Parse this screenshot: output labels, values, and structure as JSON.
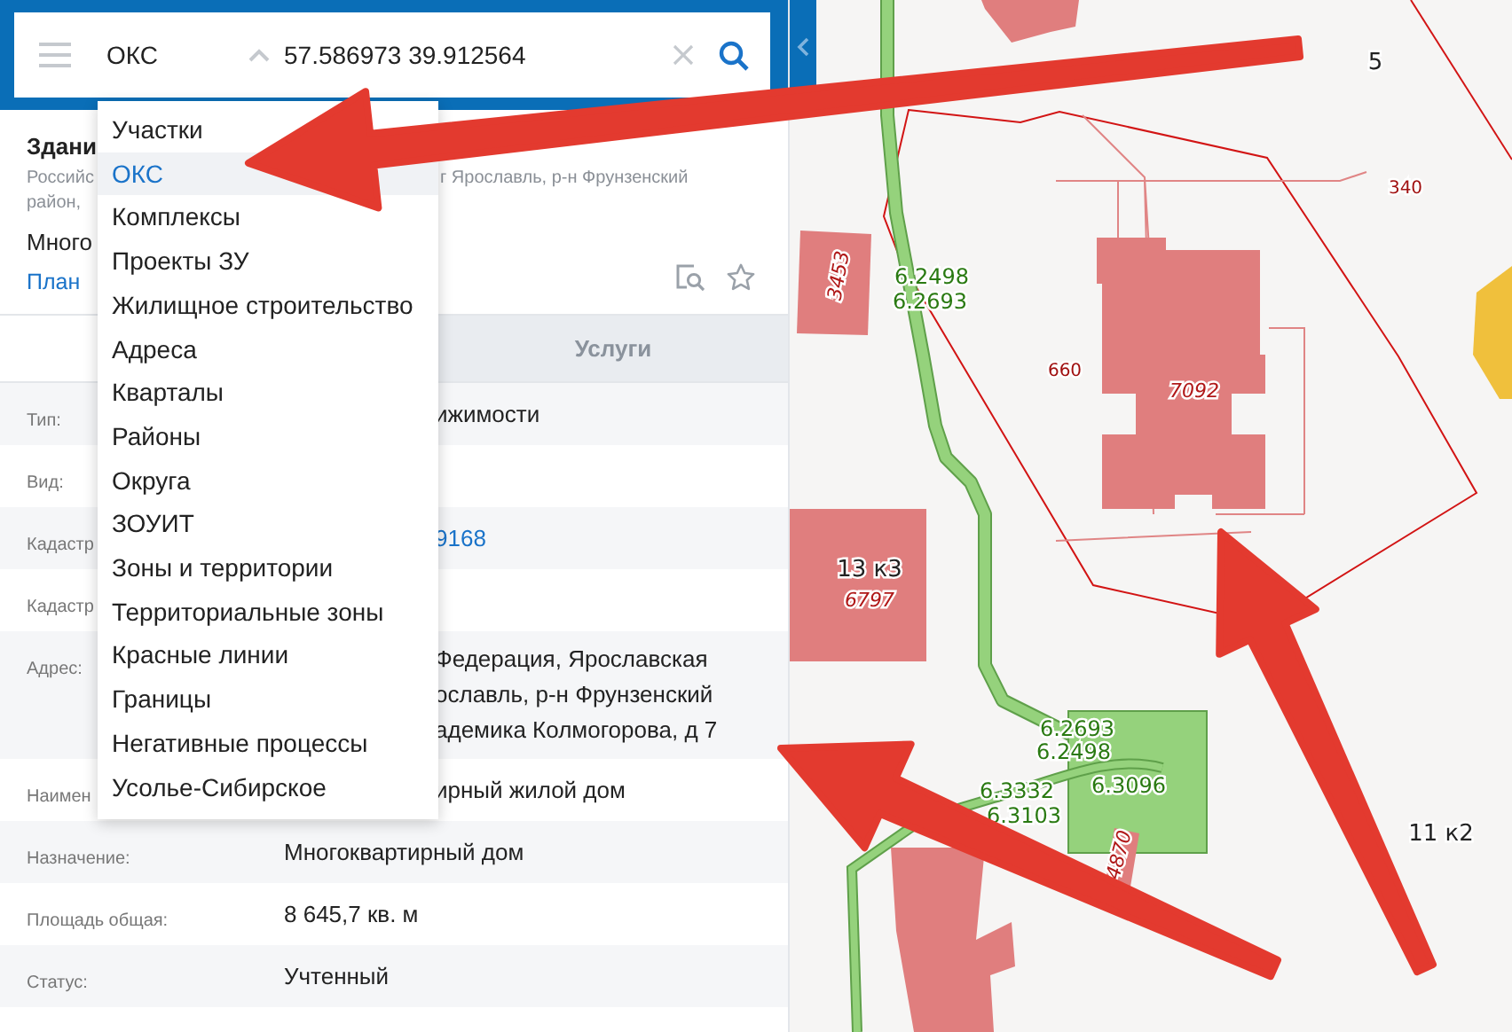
{
  "search": {
    "category": "ОКС",
    "query": "57.586973 39.912564"
  },
  "category_menu": {
    "items": [
      {
        "label": "Участки",
        "selected": false
      },
      {
        "label": "ОКС",
        "selected": true
      },
      {
        "label": "Комплексы",
        "selected": false
      },
      {
        "label": "Проекты ЗУ",
        "selected": false
      },
      {
        "label": "Жилищное строительство",
        "selected": false
      },
      {
        "label": "Адреса",
        "selected": false
      },
      {
        "label": "Кварталы",
        "selected": false
      },
      {
        "label": "Районы",
        "selected": false
      },
      {
        "label": "Округа",
        "selected": false
      },
      {
        "label": "ЗОУИТ",
        "selected": false
      },
      {
        "label": "Зоны и территории",
        "selected": false
      },
      {
        "label": "Территориальные зоны",
        "selected": false
      },
      {
        "label": "Красные линии",
        "selected": false
      },
      {
        "label": "Границы",
        "selected": false
      },
      {
        "label": "Негативные процессы",
        "selected": false
      },
      {
        "label": "Усолье-Сибирское",
        "selected": false
      }
    ]
  },
  "card": {
    "header": [
      {
        "kind": "title",
        "text": "Здани"
      },
      {
        "kind": "address",
        "text": "Российс",
        "tail": "г Ярославль, р-н Фрунзенский"
      },
      {
        "kind": "address",
        "text": "район,"
      },
      {
        "kind": "purpose",
        "text": "Много"
      },
      {
        "kind": "link",
        "text": "План"
      }
    ],
    "tabs": [
      {
        "label": "Услуги",
        "selected": false
      }
    ],
    "rows": [
      {
        "label": "Тип:",
        "value_tail": [
          "ижимости"
        ]
      },
      {
        "label": "Вид:"
      },
      {
        "label": "Кадастр",
        "value_tail": [
          "9168"
        ],
        "link": true
      },
      {
        "label": "Кадастр"
      },
      {
        "label": "Адрес:",
        "value_tail": [
          "Федерация, Ярославская",
          "ославль, р-н Фрунзенский",
          "адемика Колмогорова, д 7"
        ]
      },
      {
        "label": "Наимен",
        "value_tail": [
          "ирный жилой дом"
        ]
      },
      {
        "label": "Назначение:",
        "value": "Многоквартирный дом"
      },
      {
        "label": "Площадь общая:",
        "value": "8 645,7 кв. м"
      },
      {
        "label": "Статус:",
        "value": "Учтенный"
      }
    ]
  },
  "map": {
    "labels": [
      {
        "text": "5",
        "kind": "place"
      },
      {
        "text": "340",
        "kind": "parcel"
      },
      {
        "text": "3453",
        "kind": "building"
      },
      {
        "text": "6.2498",
        "kind": "network"
      },
      {
        "text": "6.2693",
        "kind": "network"
      },
      {
        "text": "660",
        "kind": "parcel"
      },
      {
        "text": "7092",
        "kind": "building"
      },
      {
        "text": "13 к3",
        "kind": "place"
      },
      {
        "text": "6797",
        "kind": "building"
      },
      {
        "text": "6.2693",
        "kind": "network"
      },
      {
        "text": "6.2498",
        "kind": "network"
      },
      {
        "text": "6.3332",
        "kind": "network"
      },
      {
        "text": "6.3103",
        "kind": "network"
      },
      {
        "text": "6.3096",
        "kind": "network"
      },
      {
        "text": "4870",
        "kind": "building"
      },
      {
        "text": "11 к2",
        "kind": "place"
      }
    ]
  }
}
